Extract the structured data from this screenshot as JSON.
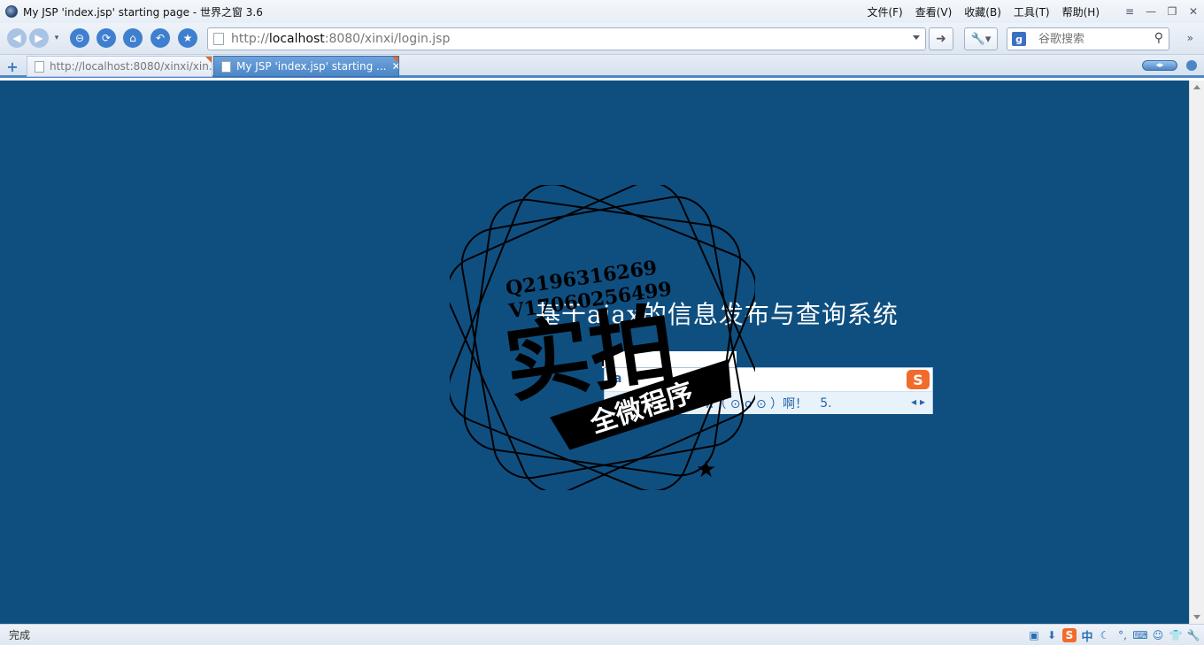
{
  "window": {
    "title": "My JSP 'index.jsp' starting page - 世界之窗 3.6",
    "menu": [
      "文件(F)",
      "查看(V)",
      "收藏(B)",
      "工具(T)",
      "帮助(H)"
    ]
  },
  "toolbar": {
    "url_prefix": "http://",
    "url_host": "localhost",
    "url_rest": ":8080/xinxi/login.jsp",
    "search_placeholder": "谷歌搜索"
  },
  "tabs": [
    {
      "label": "http://localhost:8080/xinxi/xin...",
      "active": false
    },
    {
      "label": "My JSP 'index.jsp' starting ...",
      "active": true
    }
  ],
  "page": {
    "heading": "基于ajax的信息发布与查询系统",
    "background": "#0f4f80"
  },
  "ime": {
    "composition": "a",
    "candidates": [
      "4.（ ⊙ o ⊙ ）啊！",
      "5."
    ],
    "logo": "S"
  },
  "watermark": {
    "line1": "Q2196316269",
    "line2": "V17060256499",
    "main": "实拍",
    "ribbon": "全微程序"
  },
  "status": {
    "text": "完成",
    "ime_mode": "中"
  }
}
